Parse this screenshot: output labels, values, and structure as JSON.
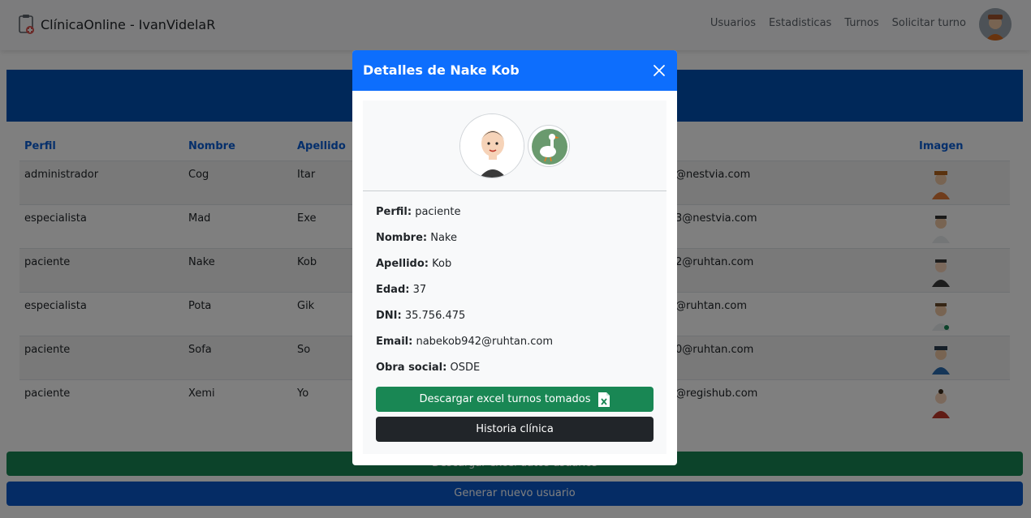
{
  "navbar": {
    "title": "ClínicaOnline - IvanVidelaR",
    "links": [
      "Usuarios",
      "Estadisticas",
      "Turnos",
      "Solicitar turno"
    ]
  },
  "table": {
    "headers": [
      "Perfil",
      "Nombre",
      "Apellido",
      "Imagen"
    ],
    "rows": [
      {
        "perfil": "administrador",
        "nombre": "Cog",
        "apellido": "Itar",
        "email": "@nestvia.com"
      },
      {
        "perfil": "especialista",
        "nombre": "Mad",
        "apellido": "Exe",
        "email": "3@nestvia.com"
      },
      {
        "perfil": "paciente",
        "nombre": "Nake",
        "apellido": "Kob",
        "email": "2@ruhtan.com"
      },
      {
        "perfil": "especialista",
        "nombre": "Pota",
        "apellido": "Gik",
        "email": "@ruhtan.com"
      },
      {
        "perfil": "paciente",
        "nombre": "Sofa",
        "apellido": "So",
        "email": "0@ruhtan.com"
      },
      {
        "perfil": "paciente",
        "nombre": "Xemi",
        "apellido": "Yo",
        "email": "@regishub.com"
      }
    ]
  },
  "background_buttons": {
    "excel_label": "Descargar excel datos usuarios",
    "new_user_label": "Generar nuevo usuario"
  },
  "modal": {
    "title": "Detalles de Nake Kob",
    "fields": [
      {
        "label": "Perfil:",
        "value": "paciente"
      },
      {
        "label": "Nombre:",
        "value": "Nake"
      },
      {
        "label": "Apellido:",
        "value": "Kob"
      },
      {
        "label": "Edad:",
        "value": "37"
      },
      {
        "label": "DNI:",
        "value": "35.756.475"
      },
      {
        "label": "Email:",
        "value": "nabekob942@ruhtan.com"
      },
      {
        "label": "Obra social:",
        "value": "OSDE"
      }
    ],
    "excel_button": "Descargar excel turnos tomados",
    "historia_button": "Historia clínica"
  },
  "colors": {
    "primary": "#0d6efd",
    "success": "#198754",
    "dark": "#212529",
    "banner": "#0050b3"
  }
}
